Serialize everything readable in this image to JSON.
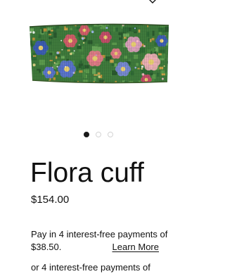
{
  "product": {
    "title": "Flora cuff",
    "price": "$154.00",
    "image_alt": "Beaded Flora cuff bracelet with floral pattern"
  },
  "gallery": {
    "slide_count": 3,
    "active_index": 0
  },
  "payment": {
    "installment_line1": "Pay in 4 interest-free payments of",
    "installment_amount": "$38.50.",
    "learn_more_label": "Learn More",
    "alt_line": "or 4 interest-free payments of"
  },
  "icons": {
    "wishlist": "heart-icon"
  },
  "colors": {
    "text": "#111111",
    "dot_active": "#1a1a1a",
    "dot_inactive": "#d4d4d4",
    "background": "#ffffff"
  }
}
